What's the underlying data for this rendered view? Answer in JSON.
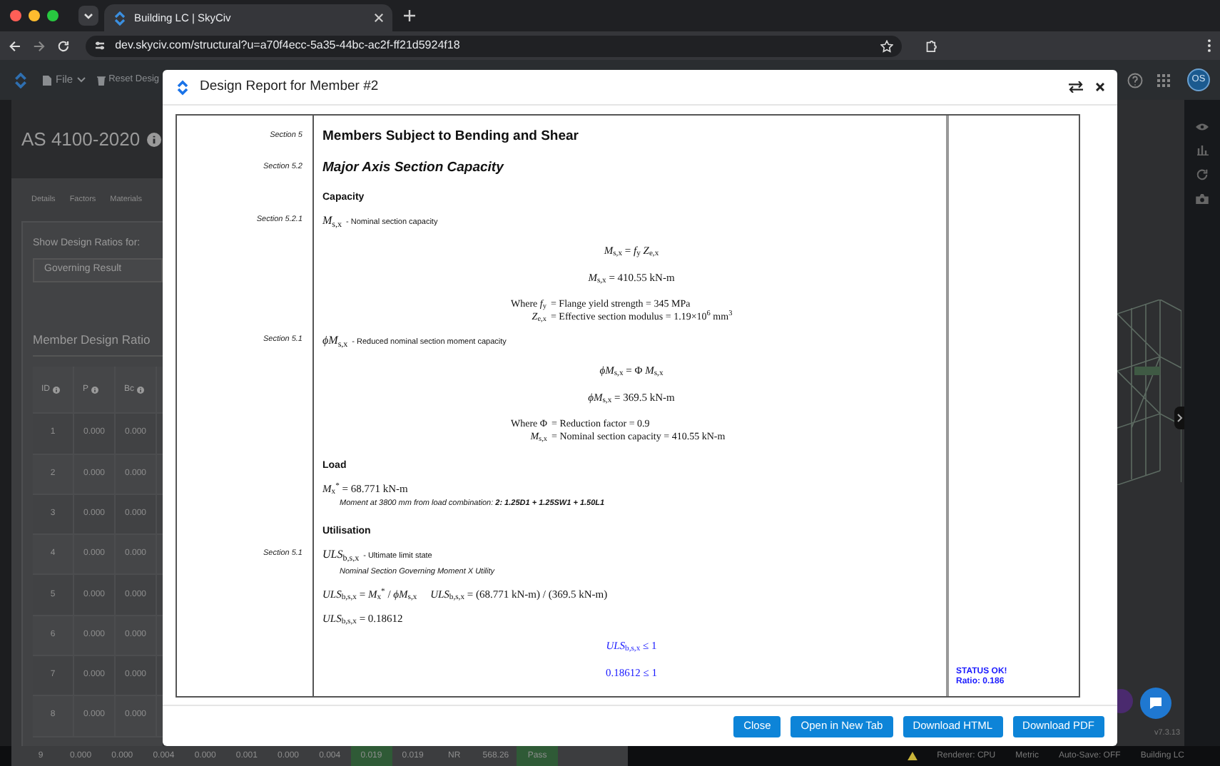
{
  "browser": {
    "tab_title": "Building LC | SkyCiv",
    "url": "dev.skyciv.com/structural?u=a70f4ecc-5a35-44bc-ac2f-ff21d5924f18"
  },
  "toolbar": {
    "menu": "File",
    "reset": "Reset Desig",
    "avatar": "OS"
  },
  "background": {
    "standard": "AS 4100-2020",
    "tabs": [
      "Details",
      "Factors",
      "Materials"
    ],
    "ratio_label": "Show Design Ratios for:",
    "ratio_select": "Governing Result",
    "table_title": "Member Design Ratio",
    "columns": [
      "ID",
      "P",
      "Bc"
    ],
    "rows": [
      [
        "1",
        "0.000",
        "0.000"
      ],
      [
        "2",
        "0.000",
        "0.000"
      ],
      [
        "3",
        "0.000",
        "0.000"
      ],
      [
        "4",
        "0.000",
        "0.000"
      ],
      [
        "5",
        "0.000",
        "0.000"
      ],
      [
        "6",
        "0.000",
        "0.000"
      ],
      [
        "7",
        "0.000",
        "0.000"
      ],
      [
        "8",
        "0.000",
        "0.000"
      ]
    ],
    "last_row": [
      {
        "text": "9",
        "pass": false
      },
      {
        "text": "0.000",
        "pass": false
      },
      {
        "text": "0.000",
        "pass": false
      },
      {
        "text": "0.004",
        "pass": false
      },
      {
        "text": "0.000",
        "pass": false
      },
      {
        "text": "0.001",
        "pass": false
      },
      {
        "text": "0.000",
        "pass": false
      },
      {
        "text": "0.004",
        "pass": false
      },
      {
        "text": "0.019",
        "pass": true
      },
      {
        "text": "0.019",
        "pass": false
      },
      {
        "text": "NR",
        "pass": false
      },
      {
        "text": "568.26",
        "pass": false
      },
      {
        "text": "Pass",
        "pass": true
      }
    ],
    "version": "v7.3.13"
  },
  "status_bar": [
    "Renderer: CPU",
    "Metric",
    "Auto-Save: OFF",
    "Building LC"
  ],
  "modal": {
    "title": "Design Report for Member #2",
    "rows": [
      {
        "kind": "title",
        "section": "Section 5",
        "text": "Members Subject to Bending and Shear"
      },
      {
        "kind": "subtitle",
        "section": "Section 5.2",
        "text": "Major Axis Section Capacity"
      },
      {
        "kind": "heading",
        "text": "Capacity"
      },
      {
        "kind": "definition",
        "section": "Section 5.2.1",
        "symbol": "*M*$_{s,x}$",
        "text": "- Nominal section capacity"
      },
      {
        "kind": "equation",
        "text": "*M*$_{s,x}$ = *f*$_{y}$ *Z*$_{e,x}$"
      },
      {
        "kind": "equation",
        "text": "*M*$_{s,x}$ = 410.55 kN-m"
      },
      {
        "kind": "where",
        "lines": [
          {
            "lhs": "Where *f*$_{y}$",
            "rhs": "= Flange yield strength = 345 MPa"
          },
          {
            "lhs": "*Z*$_{e,x}$",
            "rhs": "= Effective section modulus = 1.19×10$^{6}$ mm$^{3}$"
          }
        ]
      },
      {
        "kind": "definition",
        "section": "Section 5.1",
        "symbol": "*ϕM*$_{s,x}$",
        "text": "- Reduced nominal section moment capacity"
      },
      {
        "kind": "equation",
        "text": "*ϕM*$_{s,x}$ = Φ *M*$_{s,x}$"
      },
      {
        "kind": "equation",
        "text": "*ϕM*$_{s,x}$ = 369.5 kN-m"
      },
      {
        "kind": "where",
        "lines": [
          {
            "lhs": "Where Φ",
            "rhs": "= Reduction factor = 0.9"
          },
          {
            "lhs": "*M*$_{s,x}$",
            "rhs": "= Nominal section capacity = 410.55 kN-m"
          }
        ]
      },
      {
        "kind": "heading",
        "text": "Load"
      },
      {
        "kind": "formula",
        "text": "*M*$_{x}$$^{*}$ = 68.771 kN-m"
      },
      {
        "kind": "note",
        "text": "Moment at 3800 mm from load combination: **2: 1.25D1 + 1.25SW1 + 1.50L1**"
      },
      {
        "kind": "heading",
        "text": "Utilisation"
      },
      {
        "kind": "definition",
        "section": "Section 5.1",
        "symbol": "*ULS*$_{b,s,x}$",
        "text": "- Ultimate limit state"
      },
      {
        "kind": "note",
        "text": "Nominal Section Governing Moment X Utility"
      },
      {
        "kind": "formula",
        "text": "*ULS*$_{b,s,x}$ = *M*$_{x}$$^{*}$ / *ϕM*$_{s,x}$     *ULS*$_{b,s,x}$ = (68.771 kN-m) / (369.5 kN-m)"
      },
      {
        "kind": "formula",
        "text": "*ULS*$_{b,s,x}$ = 0.18612"
      },
      {
        "kind": "check",
        "text": "*ULS*$_{b,s,x}$ ≤ 1"
      },
      {
        "kind": "check",
        "text": "0.18612 ≤ 1"
      }
    ],
    "status": [
      "STATUS OK!",
      "Ratio: 0.186"
    ],
    "buttons": [
      "Close",
      "Open in New Tab",
      "Download HTML",
      "Download PDF"
    ]
  }
}
